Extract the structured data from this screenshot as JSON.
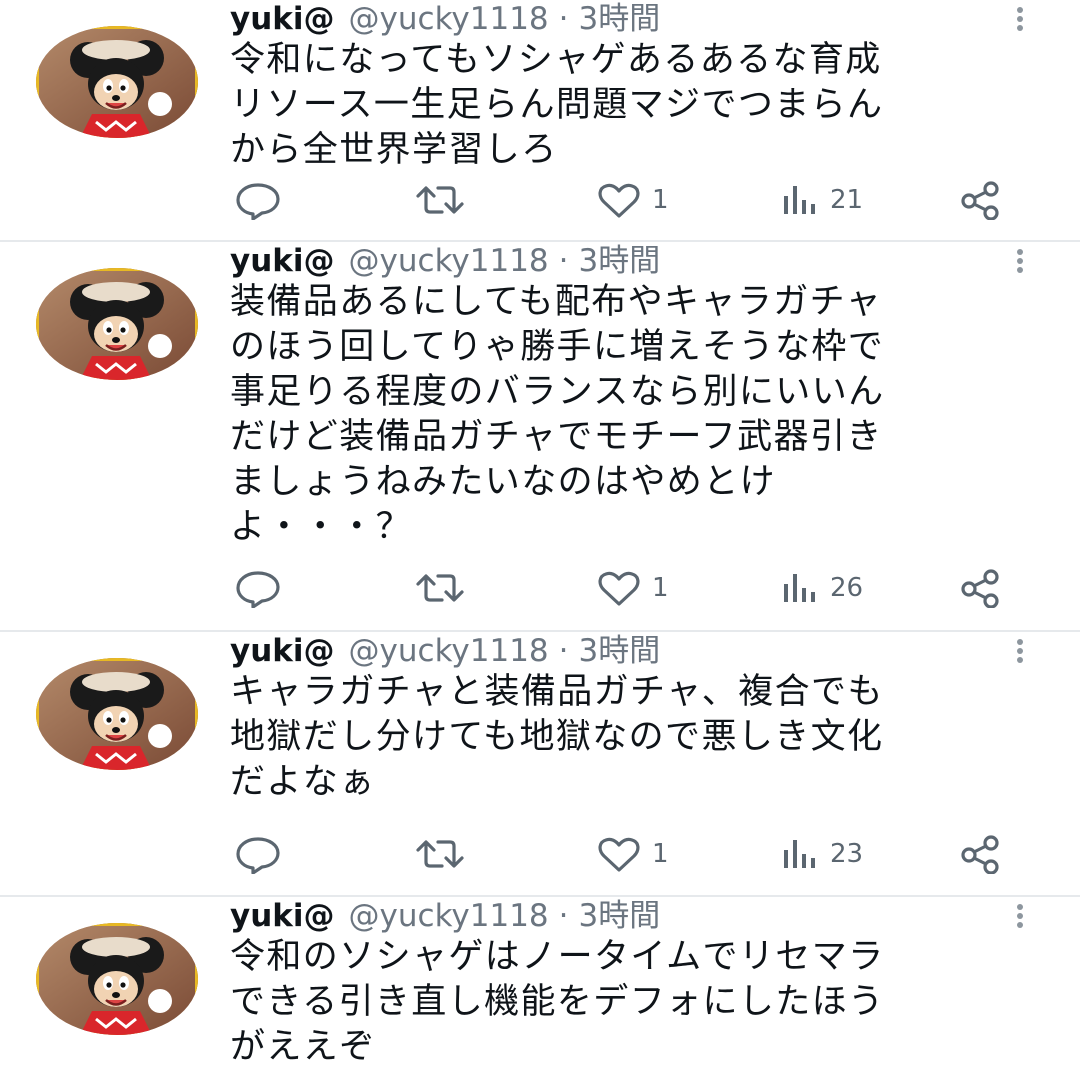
{
  "tweets": [
    {
      "name": "yuki@",
      "handle": "@yucky1118",
      "separator": "·",
      "time": "3時間",
      "text": "令和になってもソシャゲあるあるな育成\nリソース一生足らん問題マジでつまらん\nから全世界学習しろ",
      "likes": "1",
      "views": "21"
    },
    {
      "name": "yuki@",
      "handle": "@yucky1118",
      "separator": "·",
      "time": "3時間",
      "text": "装備品あるにしても配布やキャラガチャ\nのほう回してりゃ勝手に増えそうな枠で\n事足りる程度のバランスなら別にいいん\nだけど装備品ガチャでモチーフ武器引き\nましょうねみたいなのはやめとけ\nよ・・・？",
      "likes": "1",
      "views": "26"
    },
    {
      "name": "yuki@",
      "handle": "@yucky1118",
      "separator": "·",
      "time": "3時間",
      "text": "キャラガチャと装備品ガチャ、複合でも\n地獄だし分けても地獄なので悪しき文化\nだよなぁ",
      "likes": "1",
      "views": "23"
    },
    {
      "name": "yuki@",
      "handle": "@yucky1118",
      "separator": "·",
      "time": "3時間",
      "text": "令和のソシャゲはノータイムでリセマラ\nできる引き直し機能をデフォにしたほう\nがええぞ"
    }
  ],
  "icons": {
    "reply": "reply-icon",
    "retweet": "retweet-icon",
    "like": "heart-icon",
    "views": "views-icon",
    "share": "share-icon",
    "more": "more-vertical-icon",
    "avatar": "avatar-minnie-mouse"
  },
  "colors": {
    "text": "#0f1419",
    "secondary": "#6b7580",
    "icon": "#5b6670",
    "divider": "#e6e9ec"
  }
}
